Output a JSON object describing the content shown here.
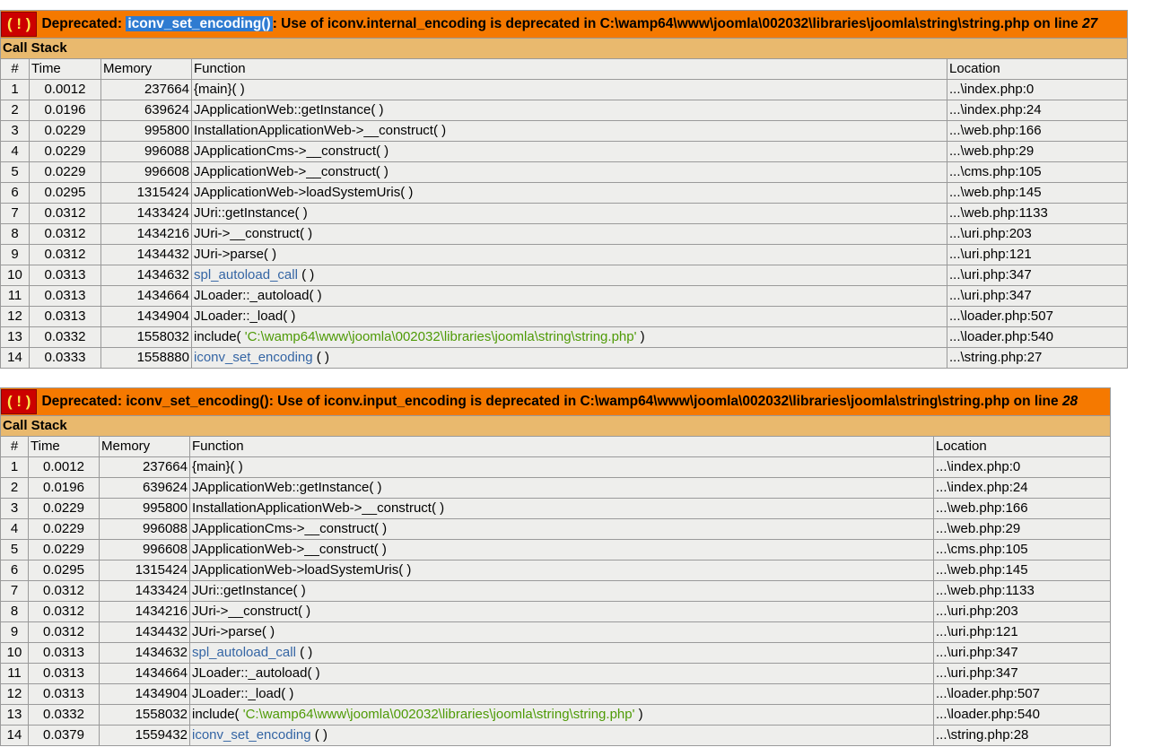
{
  "errors": [
    {
      "badge": "( ! )",
      "prefix": "Deprecated: ",
      "function": "iconv_set_encoding()",
      "message": ": Use of iconv.internal_encoding is deprecated in C:\\wamp64\\www\\joomla\\002032\\libraries\\joomla\\string\\string.php on line ",
      "line": "27",
      "call_stack_label": "Call Stack",
      "columns": {
        "num": "#",
        "time": "Time",
        "memory": "Memory",
        "function": "Function",
        "location": "Location"
      },
      "rows": [
        {
          "num": "1",
          "time": "0.0012",
          "memory": "237664",
          "function": "{main}( )",
          "location": "...\\index.php:0"
        },
        {
          "num": "2",
          "time": "0.0196",
          "memory": "639624",
          "function": "JApplicationWeb::getInstance( )",
          "location": "...\\index.php:24"
        },
        {
          "num": "3",
          "time": "0.0229",
          "memory": "995800",
          "function": "InstallationApplicationWeb->__construct( )",
          "location": "...\\web.php:166"
        },
        {
          "num": "4",
          "time": "0.0229",
          "memory": "996088",
          "function": "JApplicationCms->__construct( )",
          "location": "...\\web.php:29"
        },
        {
          "num": "5",
          "time": "0.0229",
          "memory": "996608",
          "function": "JApplicationWeb->__construct( )",
          "location": "...\\cms.php:105"
        },
        {
          "num": "6",
          "time": "0.0295",
          "memory": "1315424",
          "function": "JApplicationWeb->loadSystemUris( )",
          "location": "...\\web.php:145"
        },
        {
          "num": "7",
          "time": "0.0312",
          "memory": "1433424",
          "function": "JUri::getInstance( )",
          "location": "...\\web.php:1133"
        },
        {
          "num": "8",
          "time": "0.0312",
          "memory": "1434216",
          "function": "JUri->__construct( )",
          "location": "...\\uri.php:203"
        },
        {
          "num": "9",
          "time": "0.0312",
          "memory": "1434432",
          "function": "JUri->parse( )",
          "location": "...\\uri.php:121"
        },
        {
          "num": "10",
          "time": "0.0313",
          "memory": "1434632",
          "function": "spl_autoload_call",
          "fn_suffix": " ( )",
          "fn_link": true,
          "location": "...\\uri.php:347"
        },
        {
          "num": "11",
          "time": "0.0313",
          "memory": "1434664",
          "function": "JLoader::_autoload( )",
          "location": "...\\uri.php:347"
        },
        {
          "num": "12",
          "time": "0.0313",
          "memory": "1434904",
          "function": "JLoader::_load( )",
          "location": "...\\loader.php:507"
        },
        {
          "num": "13",
          "time": "0.0332",
          "memory": "1558032",
          "function": "include( ",
          "fn_str": "'C:\\wamp64\\www\\joomla\\002032\\libraries\\joomla\\string\\string.php'",
          "fn_suffix": " )",
          "location": "...\\loader.php:540"
        },
        {
          "num": "14",
          "time": "0.0333",
          "memory": "1558880",
          "function": "iconv_set_encoding",
          "fn_suffix": " ( )",
          "fn_link": true,
          "location": "...\\string.php:27"
        }
      ]
    },
    {
      "badge": "( ! )",
      "prefix": "Deprecated: ",
      "function": "iconv_set_encoding()",
      "message": ": Use of iconv.input_encoding is deprecated in C:\\wamp64\\www\\joomla\\002032\\libraries\\joomla\\string\\string.php on line ",
      "line": "28",
      "call_stack_label": "Call Stack",
      "columns": {
        "num": "#",
        "time": "Time",
        "memory": "Memory",
        "function": "Function",
        "location": "Location"
      },
      "rows": [
        {
          "num": "1",
          "time": "0.0012",
          "memory": "237664",
          "function": "{main}( )",
          "location": "...\\index.php:0"
        },
        {
          "num": "2",
          "time": "0.0196",
          "memory": "639624",
          "function": "JApplicationWeb::getInstance( )",
          "location": "...\\index.php:24"
        },
        {
          "num": "3",
          "time": "0.0229",
          "memory": "995800",
          "function": "InstallationApplicationWeb->__construct( )",
          "location": "...\\web.php:166"
        },
        {
          "num": "4",
          "time": "0.0229",
          "memory": "996088",
          "function": "JApplicationCms->__construct( )",
          "location": "...\\web.php:29"
        },
        {
          "num": "5",
          "time": "0.0229",
          "memory": "996608",
          "function": "JApplicationWeb->__construct( )",
          "location": "...\\cms.php:105"
        },
        {
          "num": "6",
          "time": "0.0295",
          "memory": "1315424",
          "function": "JApplicationWeb->loadSystemUris( )",
          "location": "...\\web.php:145"
        },
        {
          "num": "7",
          "time": "0.0312",
          "memory": "1433424",
          "function": "JUri::getInstance( )",
          "location": "...\\web.php:1133"
        },
        {
          "num": "8",
          "time": "0.0312",
          "memory": "1434216",
          "function": "JUri->__construct( )",
          "location": "...\\uri.php:203"
        },
        {
          "num": "9",
          "time": "0.0312",
          "memory": "1434432",
          "function": "JUri->parse( )",
          "location": "...\\uri.php:121"
        },
        {
          "num": "10",
          "time": "0.0313",
          "memory": "1434632",
          "function": "spl_autoload_call",
          "fn_suffix": " ( )",
          "fn_link": true,
          "location": "...\\uri.php:347"
        },
        {
          "num": "11",
          "time": "0.0313",
          "memory": "1434664",
          "function": "JLoader::_autoload( )",
          "location": "...\\uri.php:347"
        },
        {
          "num": "12",
          "time": "0.0313",
          "memory": "1434904",
          "function": "JLoader::_load( )",
          "location": "...\\loader.php:507"
        },
        {
          "num": "13",
          "time": "0.0332",
          "memory": "1558032",
          "function": "include( ",
          "fn_str": "'C:\\wamp64\\www\\joomla\\002032\\libraries\\joomla\\string\\string.php'",
          "fn_suffix": " )",
          "location": "...\\loader.php:540"
        },
        {
          "num": "14",
          "time": "0.0379",
          "memory": "1559432",
          "function": "iconv_set_encoding",
          "fn_suffix": " ( )",
          "fn_link": true,
          "location": "...\\string.php:28"
        }
      ]
    }
  ],
  "colors": {
    "header_bg": "#f57900",
    "callstack_bg": "#e9b96e",
    "row_bg": "#eeeeec",
    "badge_bg": "#cc0000",
    "badge_fg": "#fce94f",
    "link": "#3465a4",
    "string": "#4e9a06",
    "selection": "#2e7bd1"
  }
}
